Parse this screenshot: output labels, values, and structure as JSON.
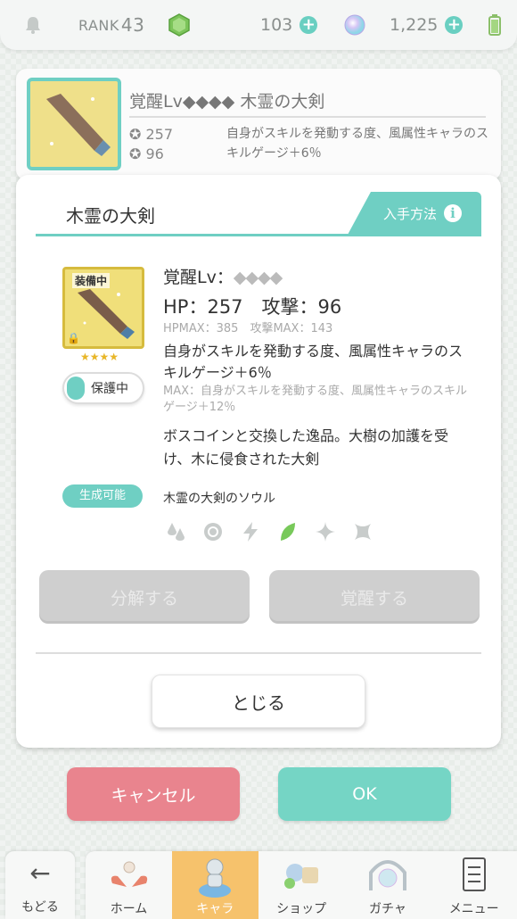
{
  "topbar": {
    "rank_label": "RANK",
    "rank_value": "43",
    "currency1": "103",
    "currency2": "1,225"
  },
  "header_card": {
    "title": "覚醒Lv◆◆◆◆ 木霊の大剣",
    "hp": "257",
    "atk": "96",
    "desc": "自身がスキルを発動する度、風属性キャラのスキルゲージ＋6％"
  },
  "modal": {
    "title": "木霊の大剣",
    "obtain_label": "入手方法",
    "equip_tag": "装備中",
    "stars": "★★★★",
    "protect_label": "保護中",
    "awaken_label": "覚醒Lv：",
    "awaken_diamonds": "◆◆◆◆",
    "hp_atk": "HP：257　攻撃：96",
    "max_line": "HPMAX：385　攻撃MAX：143",
    "skill": "自身がスキルを発動する度、風属性キャラのスキルゲージ＋6％",
    "skill_max": "MAX：自身がスキルを発動する度、風属性キャラのスキルゲージ＋12％",
    "flavor": "ボスコインと交換した逸品。大樹の加護を受け、木に侵食された大剣",
    "craft_label": "生成可能",
    "soul_name": "木霊の大剣のソウル",
    "elements": [
      "fire-drops-icon",
      "ring-icon",
      "lightning-icon",
      "leaf-icon",
      "sparkle-icon",
      "star-shuriken-icon"
    ],
    "active_element": "leaf-icon",
    "decompose_label": "分解する",
    "awaken_btn_label": "覚醒する",
    "close_label": "とじる"
  },
  "actions": {
    "cancel_label": "キャンセル",
    "ok_label": "OK"
  },
  "nav": {
    "back_label": "もどる",
    "items": [
      {
        "label": "ホーム",
        "active": false
      },
      {
        "label": "キャラ",
        "active": true
      },
      {
        "label": "ショップ",
        "active": false
      },
      {
        "label": "ガチャ",
        "active": false
      },
      {
        "label": "メニュー",
        "active": false
      }
    ]
  },
  "colors": {
    "accent": "#6fcfc3",
    "cancel": "#e9848e",
    "ok": "#75d5c5",
    "active_nav": "#f6c26c",
    "active_element": "#78c95a"
  }
}
